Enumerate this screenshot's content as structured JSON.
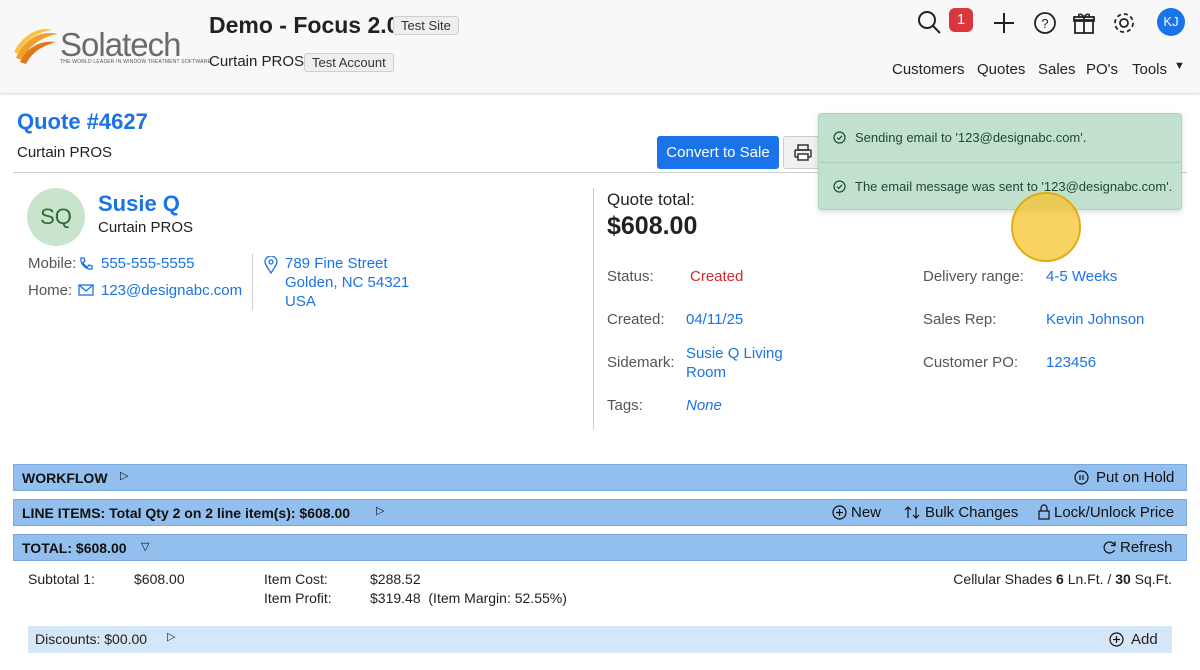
{
  "header": {
    "logo_text": "Solatech",
    "logo_tagline": "THE WORLD LEADER IN WINDOW TREATMENT SOFTWARE",
    "site_title": "Demo - Focus 2.0",
    "site_badge": "Test Site",
    "account_name": "Curtain PROS",
    "account_badge": "Test Account",
    "notification_count": "1",
    "user_initials": "KJ",
    "nav": [
      "Customers",
      "Quotes",
      "Sales",
      "PO's",
      "Tools"
    ]
  },
  "quote": {
    "title": "Quote #4627",
    "company": "Curtain PROS",
    "convert_label": "Convert to Sale"
  },
  "customer": {
    "initials": "SQ",
    "name": "Susie Q",
    "company": "Curtain PROS",
    "mobile_label": "Mobile:",
    "mobile": "555-555-5555",
    "home_label": "Home:",
    "email": "123@designabc.com",
    "address_line1": "789 Fine Street",
    "address_line2": "Golden, NC 54321",
    "address_line3": "USA"
  },
  "summary": {
    "total_label": "Quote total:",
    "total_value": "$608.00",
    "status_label": "Status:",
    "status_value": "Created",
    "created_label": "Created:",
    "created_value": "04/11/25",
    "sidemark_label": "Sidemark:",
    "sidemark_line1": "Susie Q Living",
    "sidemark_line2": "Room",
    "tags_label": "Tags:",
    "tags_value": "None",
    "delivery_label": "Delivery range:",
    "delivery_value": "4-5 Weeks",
    "rep_label": "Sales Rep:",
    "rep_value": "Kevin Johnson",
    "po_label": "Customer PO:",
    "po_value": "123456"
  },
  "sections": {
    "workflow_title": "WORKFLOW",
    "workflow_action": "Put on Hold",
    "line_items_title": "LINE ITEMS: Total Qty 2 on 2 line item(s): $608.00",
    "new_label": "New",
    "bulk_label": "Bulk Changes",
    "lock_label": "Lock/Unlock Price",
    "total_title": "TOTAL: $608.00",
    "refresh_label": "Refresh"
  },
  "totals": {
    "subtotal_label": "Subtotal 1:",
    "subtotal_value": "$608.00",
    "item_cost_label": "Item Cost:",
    "item_cost_value": "$288.52",
    "item_profit_label": "Item Profit:",
    "item_profit_value": "$319.48  (Item Margin: 52.55%)",
    "product_name": "Cellular Shades ",
    "product_lnft": "6",
    "product_lnft_unit": " Ln.Ft. / ",
    "product_sqft": "30",
    "product_sqft_unit": " Sq.Ft.",
    "discounts_label": "Discounts: $00.00",
    "add_label": "Add"
  },
  "toasts": [
    "Sending email to '123@designabc.com'.",
    "The email message was sent to '123@designabc.com'."
  ],
  "icons": [
    "search-icon",
    "plus-icon",
    "help-icon",
    "gift-icon",
    "gear-icon",
    "phone-icon",
    "mail-icon",
    "location-icon",
    "print-icon",
    "check-circle-icon"
  ],
  "colors": {
    "accent": "#1a73e8",
    "section_bar": "#93bfee",
    "toast_bg": "#c1e0cd",
    "status": "#d12b2b"
  }
}
